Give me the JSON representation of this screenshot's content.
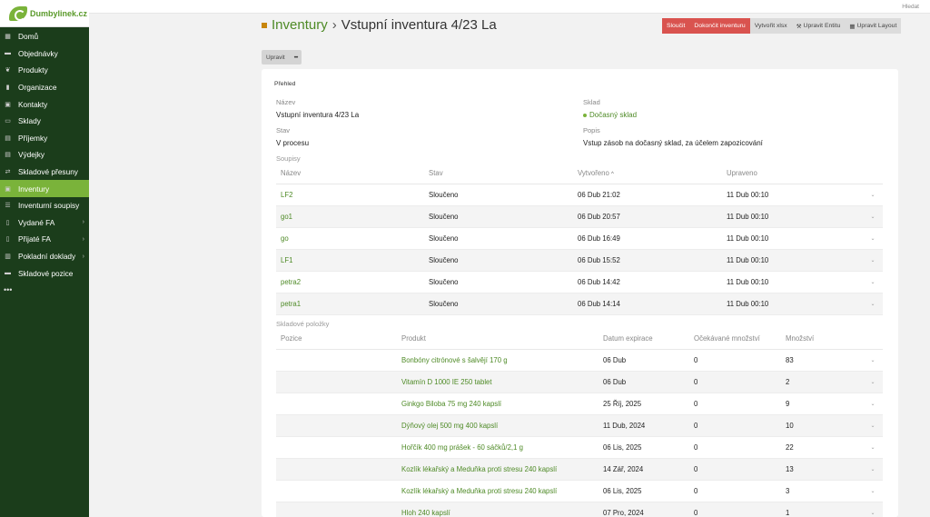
{
  "brand": {
    "name": "Dumbylinek.cz"
  },
  "topbar": {
    "search_label": "Hledat"
  },
  "sidebar": {
    "items": [
      {
        "label": "Domů",
        "icon": "grid-icon",
        "glyph": "▦",
        "active": false,
        "submenu": false
      },
      {
        "label": "Objednávky",
        "icon": "inbox-icon",
        "glyph": "▬",
        "active": false,
        "submenu": false
      },
      {
        "label": "Produkty",
        "icon": "leaf-icon",
        "glyph": "❦",
        "active": false,
        "submenu": false
      },
      {
        "label": "Organizace",
        "icon": "building-icon",
        "glyph": "▮",
        "active": false,
        "submenu": false
      },
      {
        "label": "Kontakty",
        "icon": "contact-card-icon",
        "glyph": "▣",
        "active": false,
        "submenu": false
      },
      {
        "label": "Sklady",
        "icon": "warehouse-icon",
        "glyph": "▭",
        "active": false,
        "submenu": false
      },
      {
        "label": "Příjemky",
        "icon": "boxes-in-icon",
        "glyph": "▤",
        "active": false,
        "submenu": false
      },
      {
        "label": "Výdejky",
        "icon": "boxes-out-icon",
        "glyph": "▤",
        "active": false,
        "submenu": false
      },
      {
        "label": "Skladové přesuny",
        "icon": "transfer-icon",
        "glyph": "⇄",
        "active": false,
        "submenu": false
      },
      {
        "label": "Inventury",
        "icon": "inventory-icon",
        "glyph": "▣",
        "active": true,
        "submenu": false
      },
      {
        "label": "Inventurní soupisy",
        "icon": "list-icon",
        "glyph": "☰",
        "active": false,
        "submenu": false
      },
      {
        "label": "Vydané FA",
        "icon": "invoice-out-icon",
        "glyph": "▯",
        "active": false,
        "submenu": true
      },
      {
        "label": "Přijaté FA",
        "icon": "invoice-in-icon",
        "glyph": "▯",
        "active": false,
        "submenu": true
      },
      {
        "label": "Pokladní doklady",
        "icon": "cash-receipt-icon",
        "glyph": "▥",
        "active": false,
        "submenu": true
      },
      {
        "label": "Skladové pozice",
        "icon": "shelf-icon",
        "glyph": "▬",
        "active": false,
        "submenu": false
      }
    ],
    "more_label": "•••"
  },
  "header": {
    "breadcrumb_root": "Inventury",
    "separator": "›",
    "title": "Vstupní inventura 4/23 La"
  },
  "actions": {
    "merge": "Sloučit",
    "finish": "Dokončit inventuru",
    "export": "Vytvořit xlsx",
    "edit_entity": "Upravit Entitu",
    "edit_layout": "Upravit Layout"
  },
  "subbar": {
    "edit": "Upravit",
    "more": "•••"
  },
  "overview": {
    "title": "Přehled",
    "name_label": "Název",
    "name_value": "Vstupní inventura 4/23 La",
    "warehouse_label": "Sklad",
    "warehouse_value": "Dočasný sklad",
    "status_label": "Stav",
    "status_value": "V procesu",
    "description_label": "Popis",
    "description_value": "Vstup zásob na dočasný sklad, za účelem zapozicování"
  },
  "lists": {
    "title": "Soupisy",
    "columns": [
      "Název",
      "Stav",
      "Vytvořeno",
      "Upraveno"
    ],
    "sort_indicator": "^",
    "rows": [
      {
        "name": "LF2",
        "status": "Sloučeno",
        "created": "06 Dub 21:02",
        "updated": "11 Dub 00:10"
      },
      {
        "name": "go1",
        "status": "Sloučeno",
        "created": "06 Dub 20:57",
        "updated": "11 Dub 00:10"
      },
      {
        "name": "go",
        "status": "Sloučeno",
        "created": "06 Dub 16:49",
        "updated": "11 Dub 00:10"
      },
      {
        "name": "LF1",
        "status": "Sloučeno",
        "created": "06 Dub 15:52",
        "updated": "11 Dub 00:10"
      },
      {
        "name": "petra2",
        "status": "Sloučeno",
        "created": "06 Dub 14:42",
        "updated": "11 Dub 00:10"
      },
      {
        "name": "petra1",
        "status": "Sloučeno",
        "created": "06 Dub 14:14",
        "updated": "11 Dub 00:10"
      }
    ]
  },
  "stock_items": {
    "title": "Skladové položky",
    "columns": [
      "Pozice",
      "Produkt",
      "Datum expirace",
      "Očekávané množství",
      "Množství"
    ],
    "rows": [
      {
        "position": "",
        "product": "Bonbóny citrónové s šalvějí 170 g",
        "expiry": "06 Dub",
        "expected": "0",
        "qty": "83"
      },
      {
        "position": "",
        "product": "Vitamín D 1000 IE 250 tablet",
        "expiry": "06 Dub",
        "expected": "0",
        "qty": "2"
      },
      {
        "position": "",
        "product": "Ginkgo Biloba 75 mg 240 kapslí",
        "expiry": "25 Říj, 2025",
        "expected": "0",
        "qty": "9"
      },
      {
        "position": "",
        "product": "Dýňový olej 500 mg 400 kapslí",
        "expiry": "11 Dub, 2024",
        "expected": "0",
        "qty": "10"
      },
      {
        "position": "",
        "product": "Hořčík 400 mg prášek - 60 sáčků/2,1 g",
        "expiry": "06 Lis, 2025",
        "expected": "0",
        "qty": "22"
      },
      {
        "position": "",
        "product": "Kozlík lékařský a Meduňka proti stresu 240 kapslí",
        "expiry": "14 Zář, 2024",
        "expected": "0",
        "qty": "13"
      },
      {
        "position": "",
        "product": "Kozlík lékařský a Meduňka proti stresu 240 kapslí",
        "expiry": "06 Lis, 2025",
        "expected": "0",
        "qty": "3"
      },
      {
        "position": "",
        "product": "Hloh 240 kapslí",
        "expiry": "07 Pro, 2024",
        "expected": "0",
        "qty": "1"
      }
    ]
  },
  "row_chevron": "⌄"
}
